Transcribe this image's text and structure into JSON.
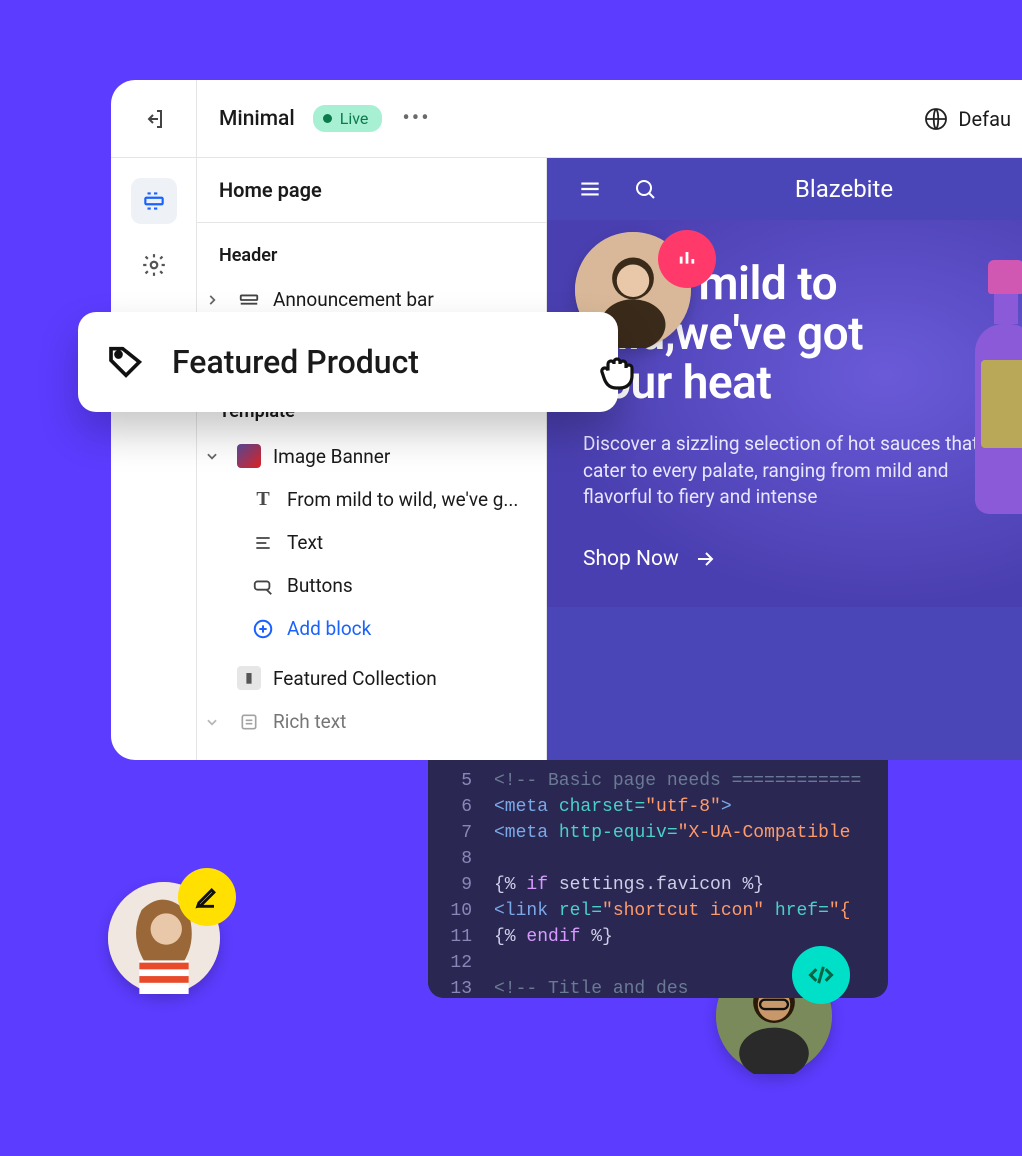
{
  "topbar": {
    "theme_name": "Minimal",
    "live_label": "Live",
    "default_label": "Defau"
  },
  "sidebar": {
    "page_title": "Home page",
    "header_label": "Header",
    "announcement": "Announcement bar",
    "template_label": "Template",
    "image_banner": "Image Banner",
    "heading_item": "From mild to wild, we've g...",
    "text_item": "Text",
    "buttons_item": "Buttons",
    "add_block": "Add block",
    "featured_collection": "Featured Collection",
    "rich_text": "Rich text"
  },
  "float_card": {
    "title": "Featured Product"
  },
  "preview": {
    "brand": "Blazebite",
    "hero_heading": "From mild to wild,we've got your heat",
    "hero_sub": "Discover a sizzling selection of hot sauces that cater to every palate, ranging from mild and flavorful to fiery and intense",
    "cta": "Shop Now"
  },
  "code": {
    "lines": [
      "5",
      "6",
      "7",
      "8",
      "9",
      "10",
      "11",
      "12",
      "13"
    ],
    "l5_comment": "<!-- Basic page needs ============",
    "l6_tag": "<meta",
    "l6_attr": "charset=",
    "l6_val": "\"utf-8\"",
    "l6_end": ">",
    "l7_tag": "<meta",
    "l7_attr": "http-equiv=",
    "l7_val": "\"X-UA-Compatible",
    "l9a": "{%",
    "l9_key": " if ",
    "l9b": "settings.favicon %}",
    "l10_tag": "<link",
    "l10_attr1": " rel=",
    "l10_val1": "\"shortcut icon\"",
    "l10_attr2": " href=",
    "l10_val2": "\"{",
    "l11a": "{%",
    "l11_key": " endif ",
    "l11b": "%}",
    "l13": "<!-- Title and des"
  }
}
